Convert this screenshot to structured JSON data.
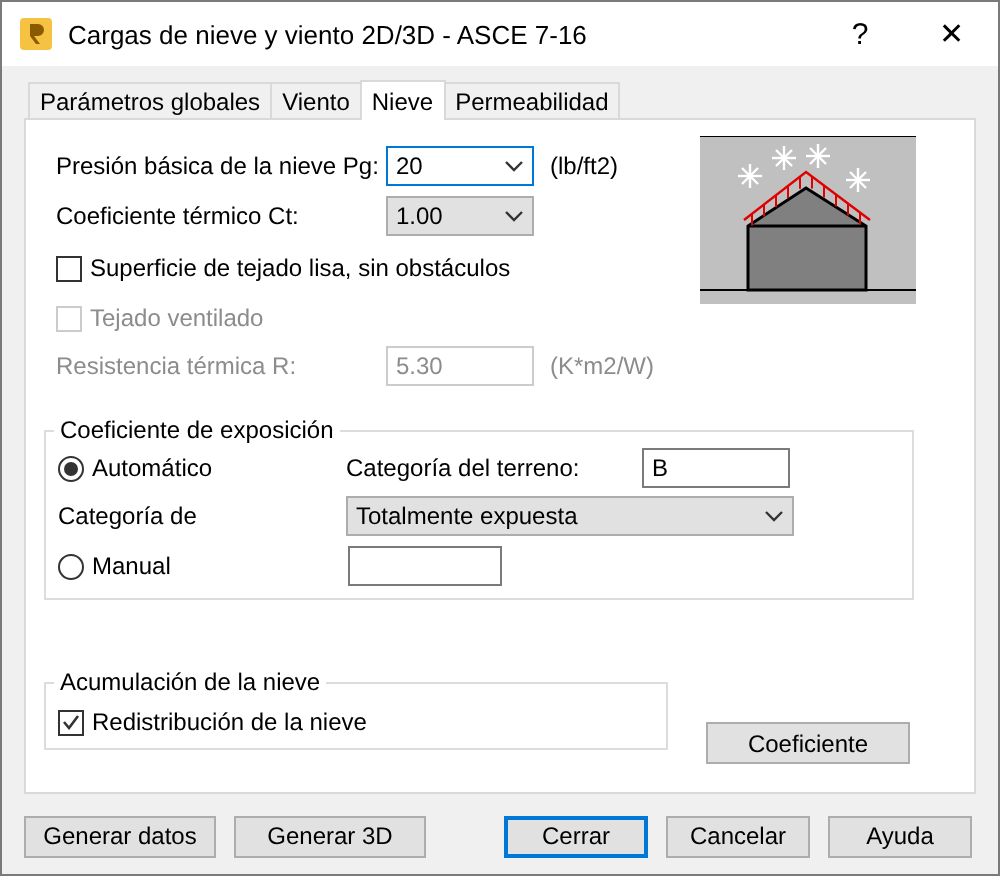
{
  "window": {
    "title": "Cargas de nieve y viento 2D/3D - ASCE 7-16",
    "help": "?",
    "close": "✕"
  },
  "tabs": [
    {
      "label": "Parámetros globales",
      "selected": false
    },
    {
      "label": "Viento",
      "selected": false
    },
    {
      "label": "Nieve",
      "selected": true
    },
    {
      "label": "Permeabilidad",
      "selected": false
    }
  ],
  "snow_pressure": {
    "label": "Presión básica de la nieve Pg:",
    "value": "20",
    "unit": "(lb/ft2)",
    "focused": true
  },
  "thermal_coefficient": {
    "label": "Coeficiente térmico Ct:",
    "value": "1.00"
  },
  "smooth_roof": {
    "label": "Superficie de tejado lisa, sin obstáculos",
    "checked": false,
    "disabled": false
  },
  "ventilated_roof": {
    "label": "Tejado ventilado",
    "checked": false,
    "disabled": true
  },
  "thermal_resistance": {
    "label": "Resistencia térmica R:",
    "value": "5.30",
    "unit": "(K*m2/W)",
    "disabled": true
  },
  "exposure": {
    "title": "Coeficiente de exposición",
    "automatic": {
      "label": "Automático",
      "selected": true
    },
    "terrain_label": "Categoría del terreno:",
    "terrain_value": "B",
    "category_label": "Categoría de",
    "category_value": "Totalmente expuesta",
    "manual": {
      "label": "Manual",
      "selected": false
    }
  },
  "accumulation": {
    "title": "Acumulación de la nieve",
    "redistribution": {
      "label": "Redistribución de la nieve",
      "checked": true,
      "disabled": false
    }
  },
  "coefficient_button": "Coeficiente",
  "buttons": [
    {
      "label": "Generar datos",
      "default": false
    },
    {
      "label": "Generar 3D",
      "default": false
    },
    {
      "label": "Cerrar",
      "default": true
    },
    {
      "label": "Cancelar",
      "default": false
    },
    {
      "label": "Ayuda",
      "default": false
    }
  ]
}
